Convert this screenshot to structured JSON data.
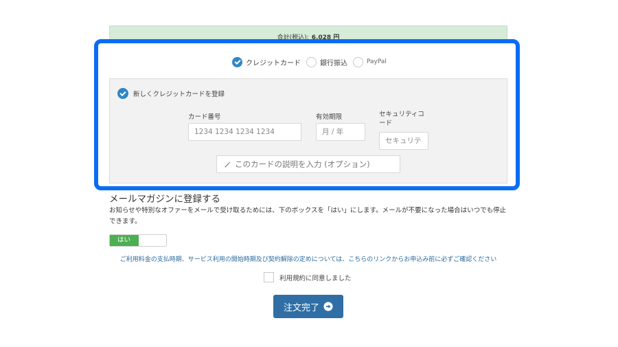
{
  "order": {
    "total_label": "合計(税込):",
    "total_value": "6,028 円"
  },
  "payment": {
    "options": [
      {
        "label": "クレジットカード",
        "selected": true
      },
      {
        "label": "銀行振込",
        "selected": false
      },
      {
        "label": "PayPal",
        "selected": false
      }
    ]
  },
  "card_form": {
    "new_card_label": "新しくクレジットカードを登録",
    "card_number_label": "カード番号",
    "card_number_placeholder": "1234 1234 1234 1234",
    "expiry_label": "有効期限",
    "expiry_placeholder": "月 / 年",
    "security_label": "セキュリティコード",
    "security_placeholder": "セキュリティ",
    "description_placeholder": "このカードの説明を入力 (オプション)"
  },
  "newsletter": {
    "title": "メールマガジンに登録する",
    "description": "お知らせや特別なオファーをメールで受け取るためには、下のボックスを「はい」にします。メールが不要になった場合はいつでも停止できます。",
    "toggle_label": "はい"
  },
  "terms": {
    "link_text": "ご利用料金の支払時期、サービス利用の開始時期及び契約解除の定めについては、こちらのリンクからお申込み前に必ずご確認ください",
    "agree_label": "利用規約に同意しました"
  },
  "submit": {
    "label": "注文完了"
  },
  "colors": {
    "accent_blue": "#0a6cf4",
    "check_blue": "#2f86c6",
    "button_blue": "#2f6fa5",
    "toggle_green": "#4caf50",
    "total_bar_green": "#d6ecd9"
  }
}
